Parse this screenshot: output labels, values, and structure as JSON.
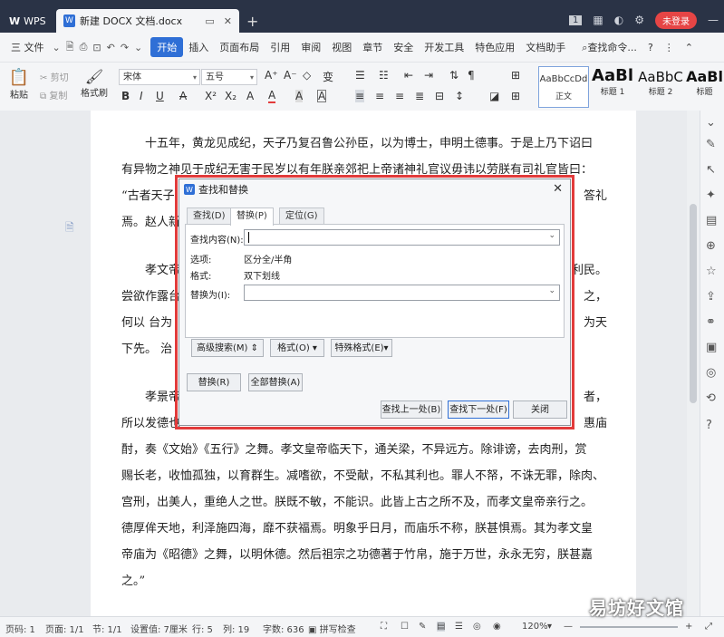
{
  "titlebar": {
    "wps_label": "WPS",
    "doc_tab_title": "新建 DOCX 文档.docx",
    "new_tab": "+",
    "page_badge": "1",
    "login_label": "未登录"
  },
  "menu": {
    "file_label": "三 文件",
    "items": [
      "开始",
      "插入",
      "页面布局",
      "引用",
      "审阅",
      "视图",
      "章节",
      "安全",
      "开发工具",
      "特色应用",
      "文档助手"
    ],
    "active_item": "开始",
    "search_label": "查找命令...",
    "help": "?"
  },
  "ribbon": {
    "paste": "粘贴",
    "cut": "剪切",
    "copy": "复制",
    "format_painter": "格式刷",
    "font_name": "宋体",
    "font_size": "五号",
    "styles": [
      {
        "preview": "AaBbCcDd",
        "name": "正文"
      },
      {
        "preview": "AaBl",
        "name": "标题 1"
      },
      {
        "preview": "AaBbC",
        "name": "标题 2"
      },
      {
        "preview": "AaBl",
        "name": "标题"
      }
    ]
  },
  "document": {
    "lines_block1": [
      "　　十五年，黄龙见成纪，天子乃复召鲁公孙臣，以为博士，申明土德事。于是上乃下诏曰",
      "有异物之神见于成纪无害于民岁以有年朕亲郊祀上帝诸神礼官议毋讳以劳朕有司礼官皆曰：",
      "“古者天子",
      "焉。赵人新"
    ],
    "lines_block2_left": [
      "　　孝文帝",
      "尝欲作露台",
      "何以 台为",
      "下先。 治"
    ],
    "lines_block2_right": [
      "利民。",
      "之，",
      "为天",
      ""
    ],
    "lines_block3": [
      "　　孝景帝",
      "所以发德也",
      "酎，奏《文始》《五行》之舞。孝文皇帝临天下，通关梁，不异远方。除诽谤，去肉刑，赏",
      "赐长老，收恤孤独，以育群生。减嗜欲，不受献，不私其利也。罪人不帑，不诛无罪，除肉、",
      "宫刑，出美人，重绝人之世。朕既不敏，不能识。此皆上古之所不及，而孝文皇帝亲行之。",
      "德厚侔天地，利泽施四海，靡不获福焉。明象乎日月，而庙乐不称，朕甚惧焉。其为孝文皇",
      "帝庙为《昭德》之舞，以明休德。然后祖宗之功德著于竹帛，施于万世，永永无穷，朕甚嘉",
      "之。”"
    ],
    "right_fragments": {
      "r1": "答礼",
      "r2": "者，",
      "r3": "惠庙"
    }
  },
  "dialog": {
    "title": "查找和替换",
    "tabs": [
      "查找(D)",
      "替换(P)",
      "定位(G)"
    ],
    "selected_tab": "替换(P)",
    "find_label": "查找内容(N):",
    "find_value": "",
    "options_label": "选项:",
    "options_value": "区分全/半角",
    "format_label": "格式:",
    "format_value": "双下划线",
    "replace_label": "替换为(I):",
    "replace_value": "",
    "advanced_btn": "高级搜索(M) ⇕",
    "format_btn": "格式(O) ▾",
    "special_btn": "特殊格式(E)▾",
    "replace_btn": "替换(R)",
    "replace_all_btn": "全部替换(A)",
    "find_prev_btn": "查找上一处(B)",
    "find_next_btn": "查找下一处(F)",
    "close_btn": "关闭"
  },
  "status": {
    "page_num": "页码: 1",
    "pages": "页面: 1/1",
    "section": "节: 1/1",
    "setting": "设置值: 7厘米",
    "row": "行: 5",
    "col": "列: 19",
    "words": "字数: 636",
    "spellcheck": "拼写检查",
    "zoom": "120%"
  },
  "watermark": "易坊好文馆",
  "colors": {
    "accent": "#2f6fd6",
    "titlebar": "#2a3346",
    "highlight_frame": "#e23b3b",
    "login": "#e64545"
  }
}
